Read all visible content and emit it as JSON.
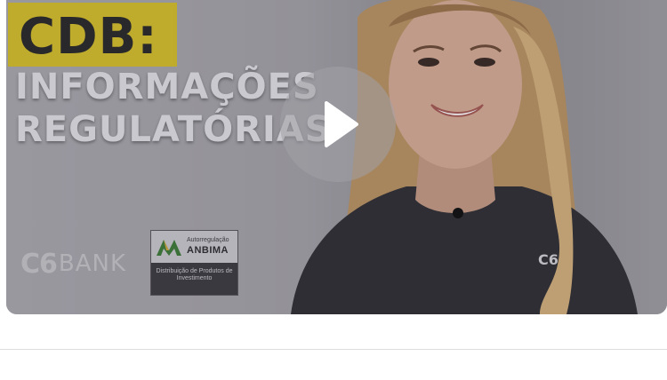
{
  "video": {
    "title_line1": "CDB:",
    "title_line2": "INFORMAÇÕES",
    "title_line3": "REGULATÓRIAS",
    "brand_c6": "C6",
    "brand_bank": "BANK",
    "shirt_logo": "C6",
    "seal": {
      "regulation_label": "Autorregulação",
      "name": "ANBIMA",
      "description": "Distribuição de Produtos de Investimento"
    },
    "play_icon": "play-icon"
  },
  "colors": {
    "title_badge": "#d4bd2b",
    "play_button": "#a0a0a5",
    "divider": "#dddddd"
  }
}
